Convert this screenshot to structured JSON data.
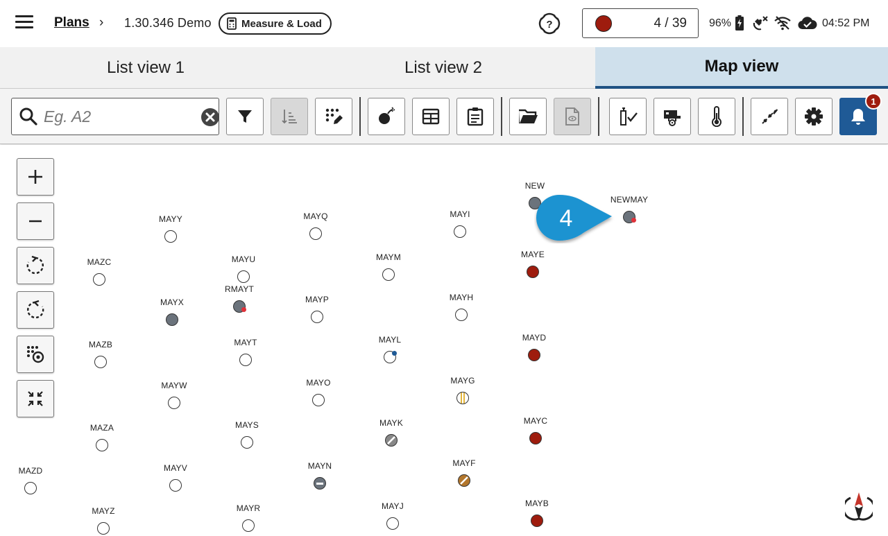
{
  "header": {
    "breadcrumb_root": "Plans",
    "breadcrumb_separator": "›",
    "project": "1.30.346 Demo",
    "mode_badge": "Measure & Load",
    "counter_text": "4 / 39",
    "counter_color": "#9e1c0e",
    "battery_pct": "96%",
    "time": "04:52 PM",
    "status_icons": [
      "battery-charging-icon",
      "satellite-off-icon",
      "wifi-off-icon",
      "cloud-done-icon"
    ]
  },
  "tabs": [
    {
      "label": "List view 1",
      "active": false
    },
    {
      "label": "List view 2",
      "active": false
    },
    {
      "label": "Map view",
      "active": true
    }
  ],
  "toolbar": {
    "search_placeholder": "Eg. A2",
    "buttons": [
      "filter-icon",
      "sort-icon",
      "select-edit-icon",
      "blast-icon",
      "table-icon",
      "clipboard-icon",
      "folder-open-icon",
      "document-view-icon",
      "load-check-icon",
      "truck-icon",
      "thermometer-icon",
      "measure-tool-icon",
      "settings-icon",
      "bell-icon"
    ],
    "notification_count": "1"
  },
  "map": {
    "controls": [
      "zoom-in-icon",
      "zoom-out-icon",
      "rotate-right-icon",
      "rotate-left-icon",
      "select-points-icon",
      "fit-extent-icon"
    ],
    "callout_label": "4",
    "accent": "#1a93d1",
    "points": [
      {
        "label": "NEW",
        "state": "grey"
      },
      {
        "label": "NEWMAY",
        "state": "grey-flag"
      },
      {
        "label": "MAYY",
        "state": "empty"
      },
      {
        "label": "MAYQ",
        "state": "empty"
      },
      {
        "label": "MAYI",
        "state": "empty"
      },
      {
        "label": "MAZC",
        "state": "empty"
      },
      {
        "label": "MAYU",
        "state": "empty"
      },
      {
        "label": "MAYM",
        "state": "empty"
      },
      {
        "label": "MAYE",
        "state": "red"
      },
      {
        "label": "RMAYT",
        "state": "grey-flag"
      },
      {
        "label": "MAYX",
        "state": "grey"
      },
      {
        "label": "MAYP",
        "state": "empty"
      },
      {
        "label": "MAYH",
        "state": "empty"
      },
      {
        "label": "MAZB",
        "state": "empty"
      },
      {
        "label": "MAYT",
        "state": "empty"
      },
      {
        "label": "MAYL",
        "state": "empty-blue"
      },
      {
        "label": "MAYD",
        "state": "red"
      },
      {
        "label": "MAYW",
        "state": "empty"
      },
      {
        "label": "MAYO",
        "state": "empty"
      },
      {
        "label": "MAYG",
        "state": "split"
      },
      {
        "label": "MAZA",
        "state": "empty"
      },
      {
        "label": "MAYS",
        "state": "empty"
      },
      {
        "label": "MAYK",
        "state": "slash"
      },
      {
        "label": "MAYC",
        "state": "red"
      },
      {
        "label": "MAZD",
        "state": "empty"
      },
      {
        "label": "MAYV",
        "state": "empty"
      },
      {
        "label": "MAYN",
        "state": "minus"
      },
      {
        "label": "MAYF",
        "state": "brown"
      },
      {
        "label": "MAYZ",
        "state": "empty"
      },
      {
        "label": "MAYR",
        "state": "empty"
      },
      {
        "label": "MAYJ",
        "state": "empty"
      },
      {
        "label": "MAYB",
        "state": "red"
      }
    ]
  }
}
